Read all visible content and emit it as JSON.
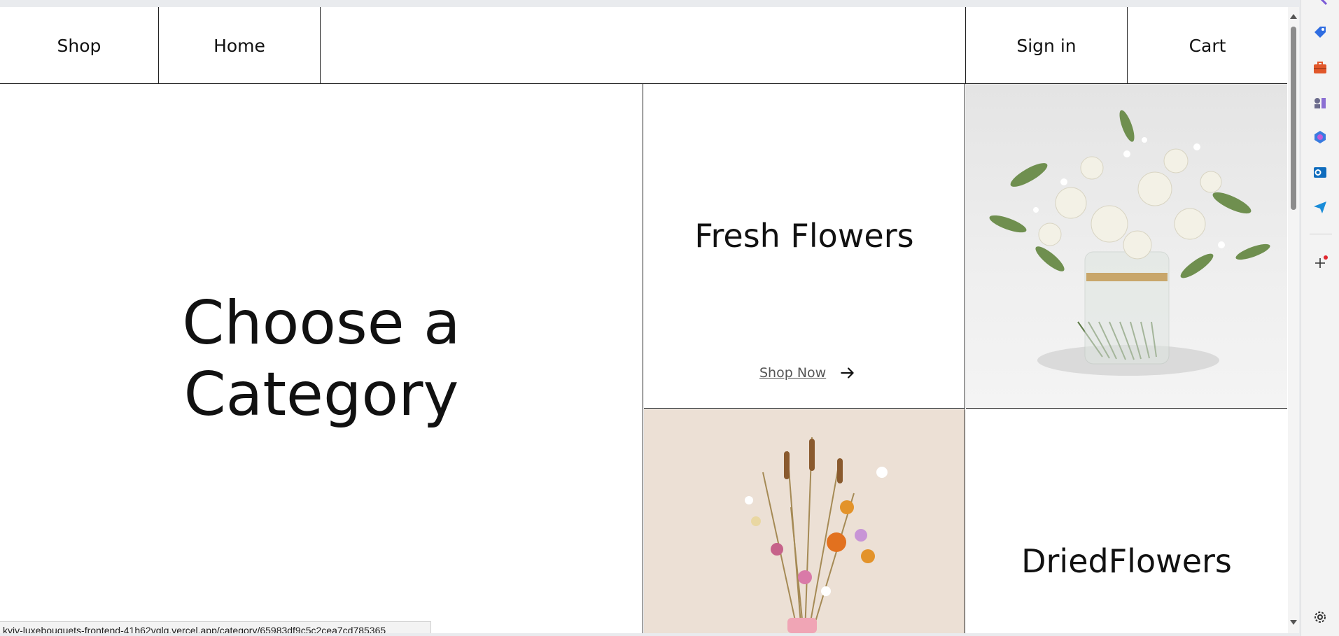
{
  "nav": {
    "shop_label": "Shop",
    "home_label": "Home",
    "signin_label": "Sign in",
    "cart_label": "Cart"
  },
  "hero": {
    "title": "Choose a Category"
  },
  "categories": [
    {
      "title": "Fresh Flowers",
      "cta": "Shop Now",
      "image_icon": "white-bouquet-image"
    },
    {
      "title": "DriedFlowers",
      "image_icon": "dried-bouquet-image"
    }
  ],
  "status_bar": {
    "url": "kyiv-luxebouquets-frontend-41h62vglq.vercel.app/category/65983df9c5c2cea7cd785365"
  },
  "sidebar_icons": [
    "sparkle-icon",
    "tag-icon",
    "briefcase-icon",
    "chess-icon",
    "copilot-icon",
    "outlook-icon",
    "send-icon",
    "add-icon",
    "settings-icon"
  ],
  "colors": {
    "text": "#111111",
    "border": "#222222",
    "dried_bg": "#ece0d5"
  }
}
